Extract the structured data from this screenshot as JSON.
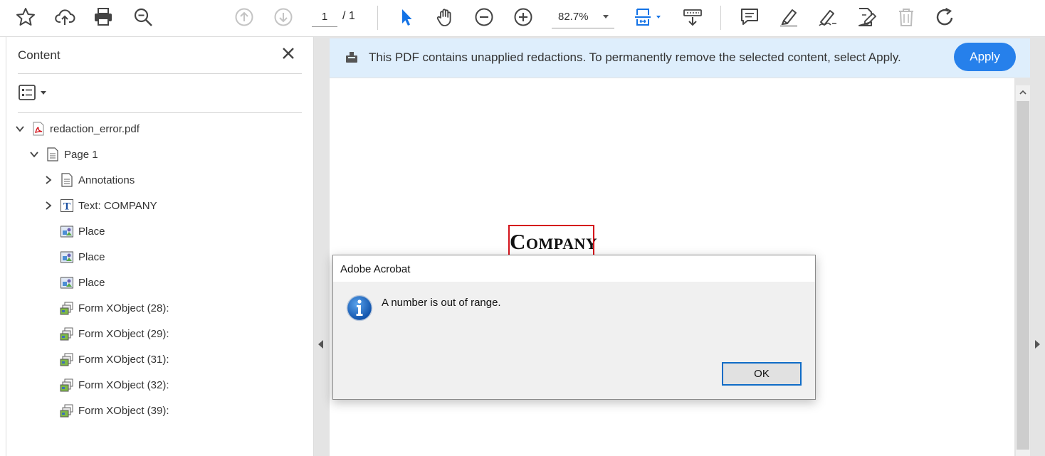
{
  "toolbar": {
    "page_current": "1",
    "page_total": "/ 1",
    "zoom": "82.7%"
  },
  "panel": {
    "title": "Content",
    "tree": [
      {
        "label": "redaction_error.pdf",
        "icon": "pdf-file-icon",
        "expanded": true
      },
      {
        "label": "Page 1",
        "icon": "page-icon",
        "expanded": true
      },
      {
        "label": "Annotations",
        "icon": "annotations-icon",
        "expanded": false
      },
      {
        "label": "Text: COMPANY",
        "icon": "text-object-icon",
        "expanded": false
      },
      {
        "label": "Place",
        "icon": "image-object-icon"
      },
      {
        "label": "Place",
        "icon": "image-object-icon"
      },
      {
        "label": "Place",
        "icon": "image-object-icon"
      },
      {
        "label": "Form XObject (28):",
        "icon": "form-xobject-icon"
      },
      {
        "label": "Form XObject (29):",
        "icon": "form-xobject-icon"
      },
      {
        "label": "Form XObject (31):",
        "icon": "form-xobject-icon"
      },
      {
        "label": "Form XObject (32):",
        "icon": "form-xobject-icon"
      },
      {
        "label": "Form XObject (39):",
        "icon": "form-xobject-icon"
      }
    ]
  },
  "notice": {
    "text": "This PDF contains unapplied redactions. To permanently remove the selected content, select Apply.",
    "apply_label": "Apply"
  },
  "document": {
    "company_first": "C",
    "company_rest": "OMPANY"
  },
  "dialog": {
    "title": "Adobe Acrobat",
    "message": "A number is out of range.",
    "ok_label": "OK"
  },
  "colors": {
    "accent": "#2680eb",
    "notice_bg": "#deeefc",
    "redaction": "#d4131b",
    "select_tool": "#1473e6"
  }
}
